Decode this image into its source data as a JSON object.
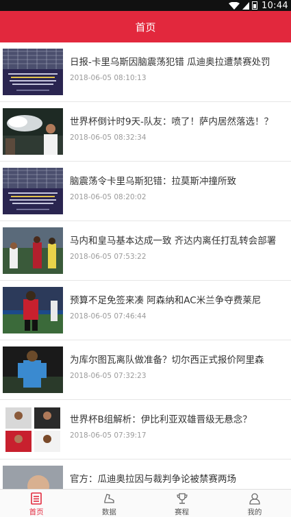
{
  "status_bar": {
    "time": "10:44"
  },
  "header": {
    "title": "首页"
  },
  "news": [
    {
      "title": "日报-卡里乌斯因脑震荡犯错 瓜迪奥拉遭禁赛处罚",
      "time": "2018-06-05 08:10:13",
      "thumb": "concussion-statement-image"
    },
    {
      "title": "世界杯倒计时9天-队友：喷了！萨内居然落选！？",
      "time": "2018-06-05 08:32:34",
      "thumb": "player-spray-image"
    },
    {
      "title": "脑震荡令卡里乌斯犯错：拉莫斯冲撞所致",
      "time": "2018-06-05 08:20:02",
      "thumb": "concussion-statement-image"
    },
    {
      "title": "马内和皇马基本达成一致 齐达内离任打乱转会部署",
      "time": "2018-06-05 07:53:22",
      "thumb": "match-players-image"
    },
    {
      "title": "预算不足免签来凑 阿森纳和AC米兰争夺费莱尼",
      "time": "2018-06-05 07:46:44",
      "thumb": "belgium-player-image"
    },
    {
      "title": "为库尔图瓦离队做准备？切尔西正式报价阿里森",
      "time": "2018-06-05 07:32:23",
      "thumb": "goalkeeper-image"
    },
    {
      "title": "世界杯B组解析：伊比利亚双雄晋级无悬念？",
      "time": "2018-06-05 07:39:17",
      "thumb": "players-collage-image"
    },
    {
      "title": "官方：瓜迪奥拉因与裁判争论被禁赛两场",
      "time": "",
      "thumb": "coach-image"
    }
  ],
  "bottom_nav": [
    {
      "label": "首页",
      "icon": "home-icon",
      "active": true
    },
    {
      "label": "数据",
      "icon": "boot-icon",
      "active": false
    },
    {
      "label": "赛程",
      "icon": "trophy-icon",
      "active": false
    },
    {
      "label": "我的",
      "icon": "user-icon",
      "active": false
    }
  ],
  "colors": {
    "accent": "#e2283d",
    "status_bar": "#111111",
    "divider": "#e6e6e6",
    "time_text": "#9a9a9a"
  }
}
